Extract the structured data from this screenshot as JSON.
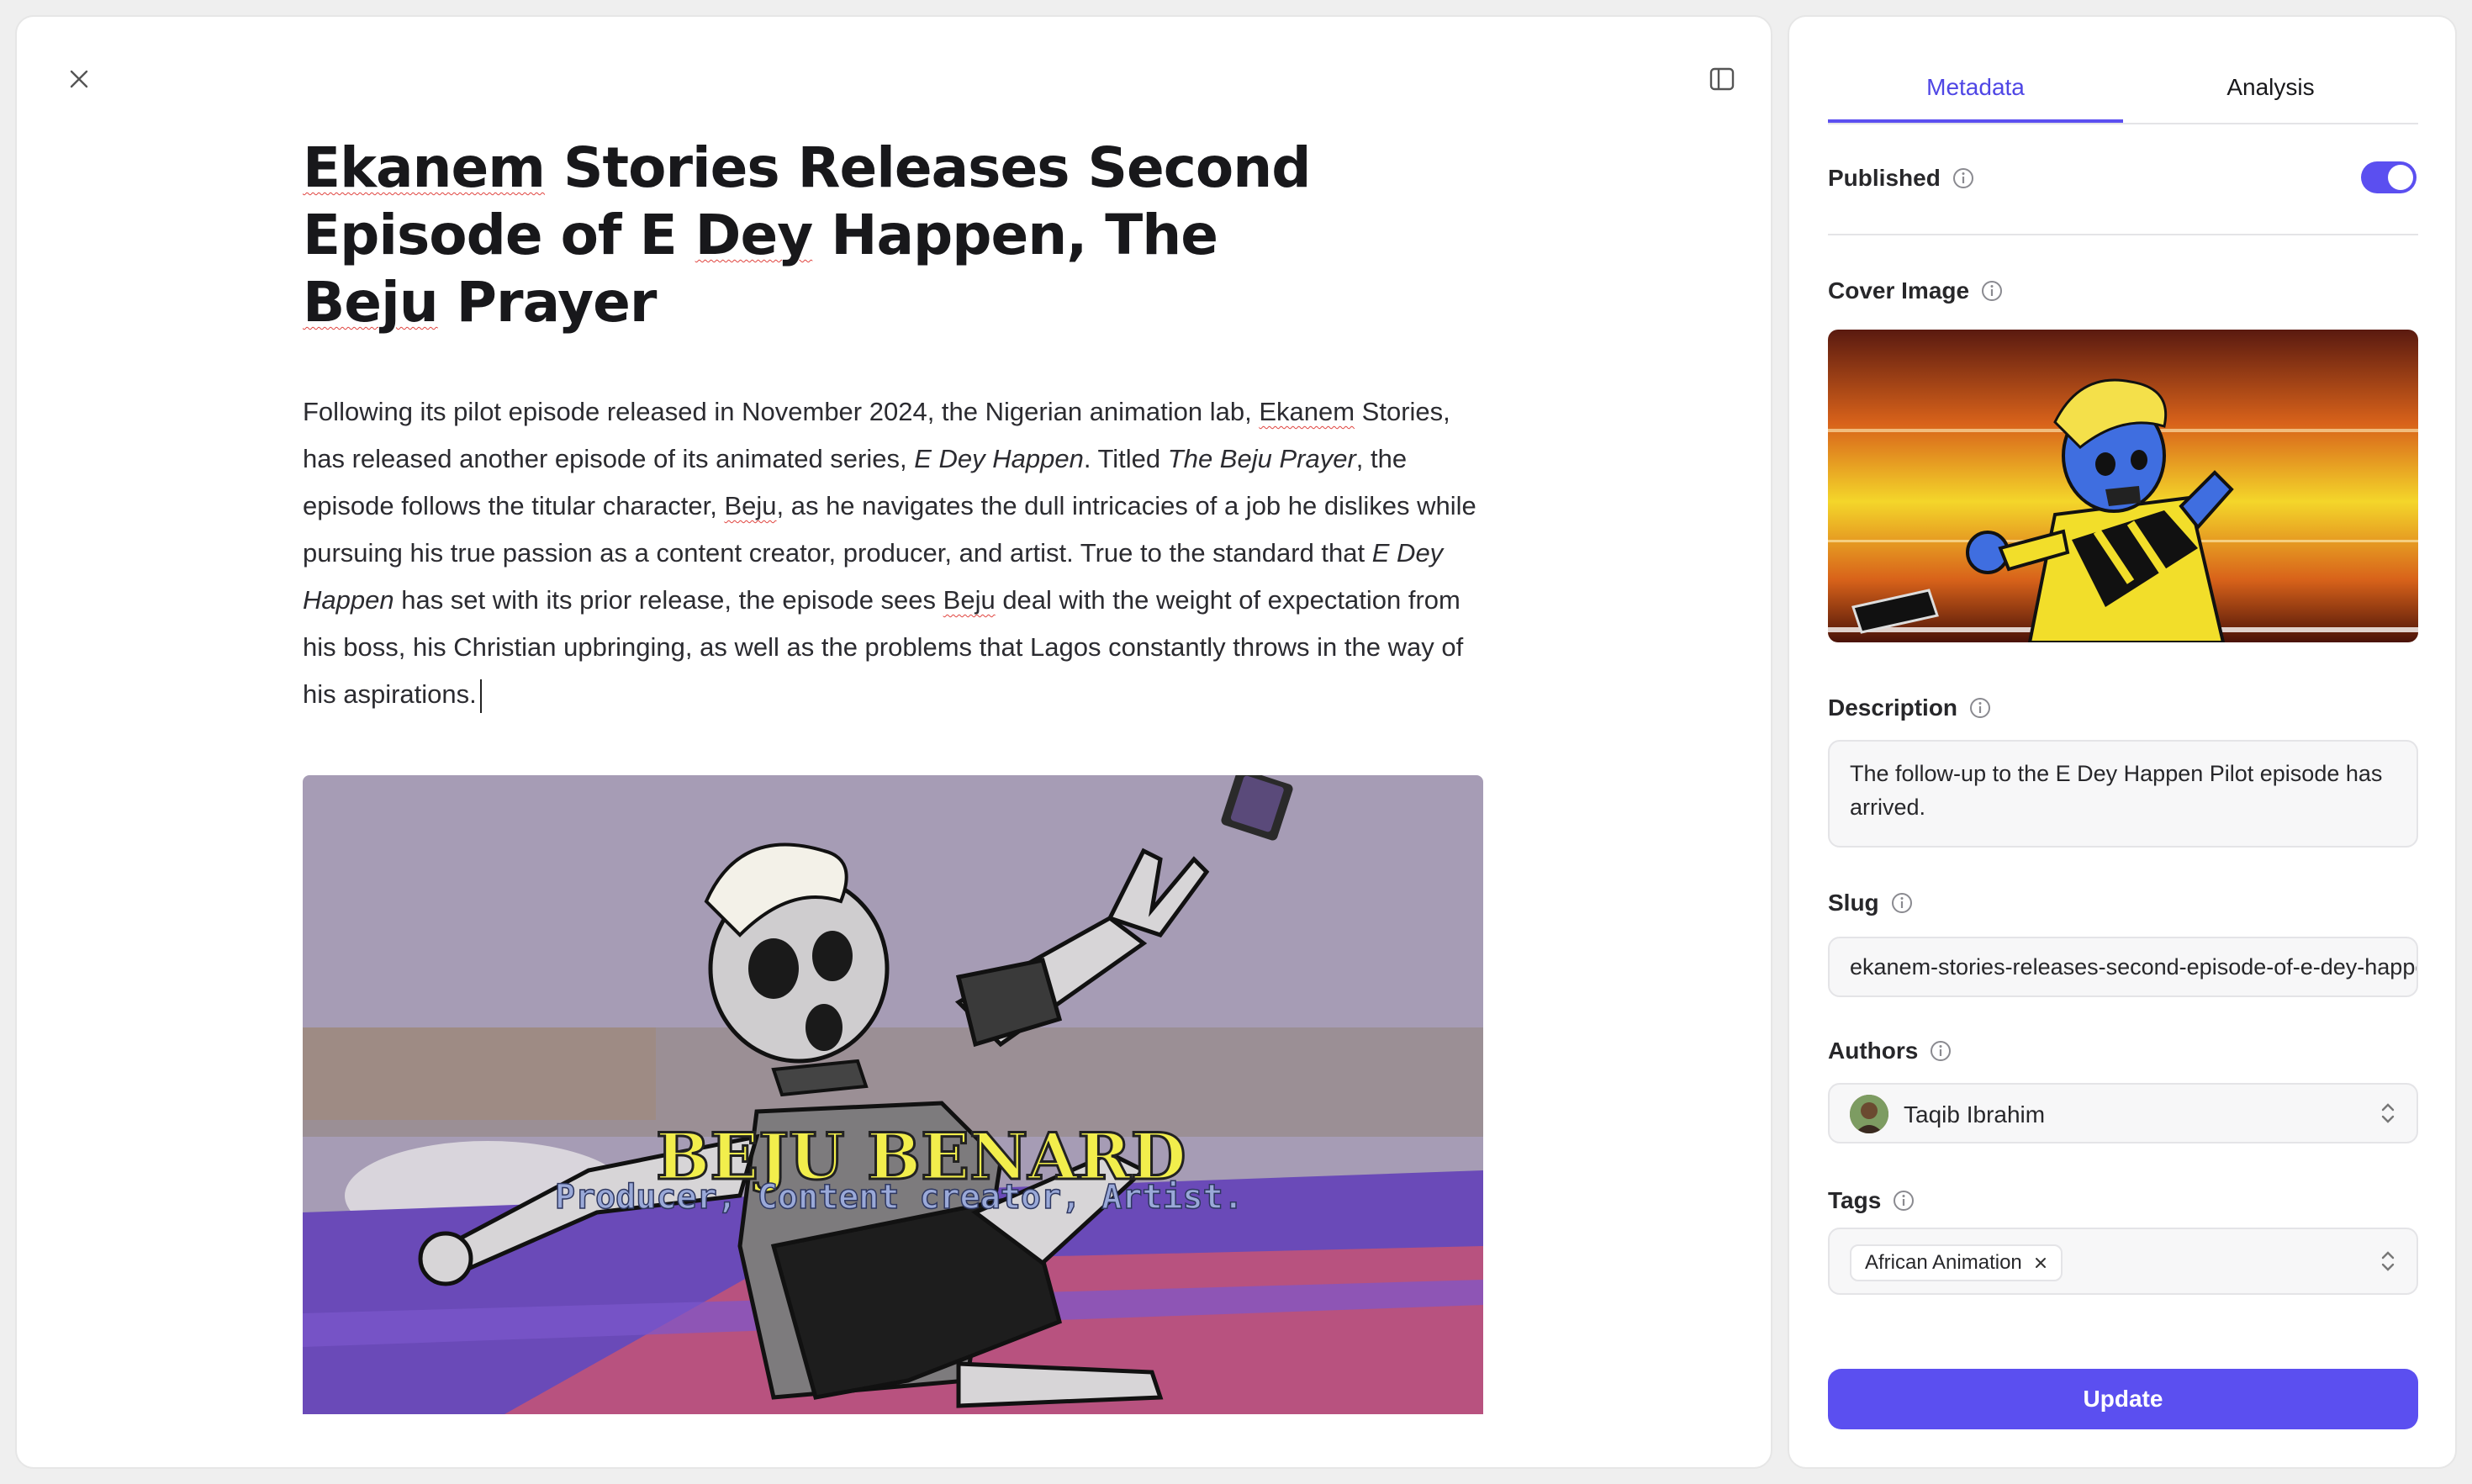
{
  "editor": {
    "title_parts": [
      "Ekanem",
      " Stories Releases Second Episode of E ",
      "Dey",
      " Happen, The ",
      "Beju",
      " Prayer"
    ],
    "body": {
      "p1": "Following its pilot episode released in November 2024, the Nigerian animation lab, ",
      "p2": "Ekanem",
      "p3": " Stories, has released another episode of its animated series, ",
      "p4": "E Dey Happen",
      "p5": ". Titled ",
      "p6": "The Beju Prayer",
      "p7": ", the episode follows the titular character, ",
      "p8": "Beju",
      "p9": ", as he navigates the dull intricacies of a job he dislikes while pursuing his true passion as a content creator, producer, and artist. True to the standard that ",
      "p10": "E Dey Happen",
      "p11": " has set with its prior release, the episode sees ",
      "p12": "Beju",
      "p13": " deal with the weight of expectation from his boss, his Christian upbringing, as well as the problems that Lagos constantly throws in the way of his aspirations."
    },
    "hero_image": {
      "name_text": "BEJU BENARD",
      "role_text": "Producer, Content creator, Artist."
    }
  },
  "sidebar": {
    "tabs": [
      {
        "label": "Metadata",
        "active": true
      },
      {
        "label": "Analysis",
        "active": false
      }
    ],
    "published_label": "Published",
    "published": true,
    "cover_label": "Cover Image",
    "description_label": "Description",
    "description_value": "The follow-up to the E Dey Happen Pilot episode has arrived.",
    "slug_label": "Slug",
    "slug_value": "ekanem-stories-releases-second-episode-of-e-dey-happen",
    "authors_label": "Authors",
    "author_name": "Taqib Ibrahim",
    "tags_label": "Tags",
    "tags": [
      "African Animation"
    ],
    "update_label": "Update"
  },
  "colors": {
    "accent": "#5b4ff0",
    "accent_text": "#4f46e5",
    "spellcheck": "#e0443f"
  }
}
